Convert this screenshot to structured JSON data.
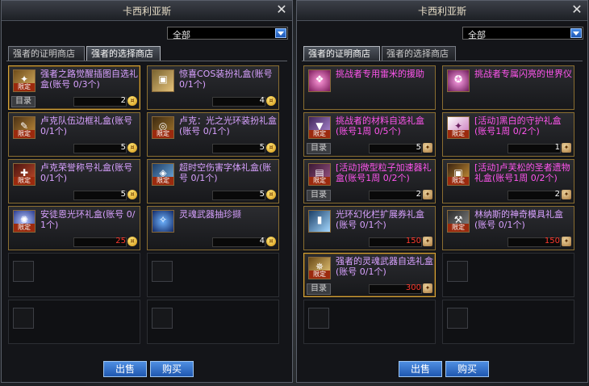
{
  "left_shop": {
    "title": "卡西利亚斯",
    "filter": "全部",
    "tabs": [
      "强者的证明商店",
      "强者的选择商店"
    ],
    "items": [
      {
        "name": "强者之路觉醒插图自选礼盒(账号 0/3个)",
        "tag": "限定",
        "catalog": "目录",
        "price": "2",
        "currency": "coin"
      },
      {
        "name": "惊喜COS装扮礼盒(账号 0/1个)",
        "tag": "",
        "catalog": "",
        "price": "4",
        "currency": "coin"
      },
      {
        "name": "卢克队伍边框礼盒(账号 0/1个)",
        "tag": "限定",
        "catalog": "",
        "price": "5",
        "currency": "coin"
      },
      {
        "name": "卢克：光之光环装扮礼盒(账号 0/1个)",
        "tag": "限定",
        "catalog": "",
        "price": "5",
        "currency": "coin"
      },
      {
        "name": "卢克荣誉称号礼盒(账号 0/1个)",
        "tag": "限定",
        "catalog": "",
        "price": "5",
        "currency": "coin"
      },
      {
        "name": "超时空伤害字体礼盒(账号 0/1个)",
        "tag": "限定",
        "catalog": "",
        "price": "5",
        "currency": "coin"
      },
      {
        "name": "安徒恩光环礼盒(账号 0/1个)",
        "tag": "限定",
        "catalog": "",
        "price": "25",
        "currency": "coin"
      },
      {
        "name": "灵魂武器抽珍撷",
        "tag": "",
        "catalog": "",
        "price": "4",
        "currency": "coin"
      }
    ],
    "sell": "出售",
    "buy": "购买"
  },
  "right_shop": {
    "title": "卡西利亚斯",
    "filter": "全部",
    "tabs": [
      "强者的证明商店",
      "强者的选择商店"
    ],
    "items": [
      {
        "name": "挑战者专用雷米的援助",
        "tag": "",
        "catalog": "",
        "price": "",
        "currency": ""
      },
      {
        "name": "挑战者专属闪亮的世界仪",
        "tag": "",
        "catalog": "",
        "price": "",
        "currency": ""
      },
      {
        "name": "挑战者的材料自选礼盒(账号1周 0/5个)",
        "tag": "限定",
        "catalog": "目录",
        "price": "5",
        "currency": "token"
      },
      {
        "name": "[活动]黑白的守护礼盒(账号1周 0/2个)",
        "tag": "限定",
        "catalog": "",
        "price": "1",
        "currency": "token"
      },
      {
        "name": "[活动]微型粒子加速器礼盒(账号1周 0/2个)",
        "tag": "限定",
        "catalog": "目录",
        "price": "2",
        "currency": "token"
      },
      {
        "name": "[活动]卢芙松的圣者遗物礼盒(账号1周 0/2个)",
        "tag": "限定",
        "catalog": "",
        "price": "2",
        "currency": "token"
      },
      {
        "name": "光环幻化栏扩展券礼盒(账号 0/1个)",
        "tag": "",
        "catalog": "",
        "price": "150",
        "currency": "token"
      },
      {
        "name": "林纳斯的神奇模具礼盒(账号 0/1个)",
        "tag": "限定",
        "catalog": "",
        "price": "150",
        "currency": "token"
      },
      {
        "name": "强者的灵魂武器自选礼盒(账号 0/1个)",
        "tag": "限定",
        "catalog": "目录",
        "price": "300",
        "currency": "token"
      }
    ],
    "sell": "出售",
    "buy": "购买"
  },
  "colors": {
    "coin": "#f2c13c",
    "token": "#c99a5a",
    "accent": "#2b6fd4",
    "price_red": "#ff3a2f"
  }
}
